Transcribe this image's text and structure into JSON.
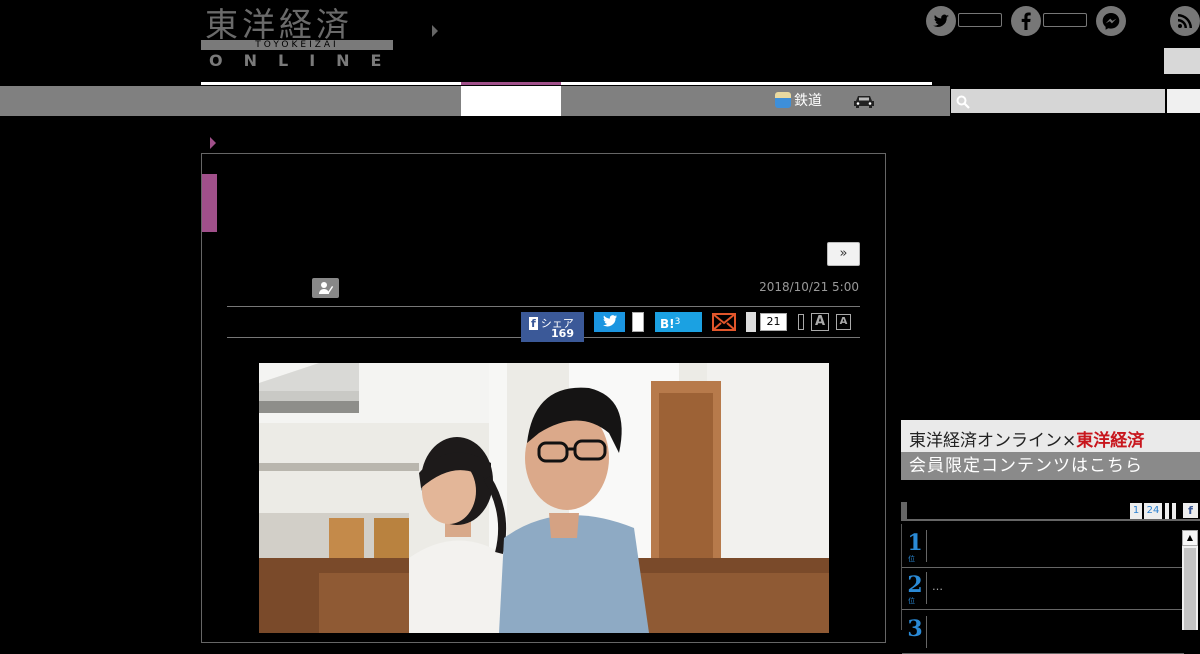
{
  "logo": {
    "kanji": "東洋経済",
    "band": "TOYOKEIZAI",
    "online": "ONLINE"
  },
  "nav": {
    "rail_label": "鉄道"
  },
  "article": {
    "next_label": "»",
    "date": "2018/10/21 5:00",
    "share": {
      "facebook_label": "シェア",
      "facebook_count": "169",
      "hatena_label": "B!",
      "hatena_count": "3",
      "comment_count": "21",
      "font_large": "A",
      "font_small": "A"
    }
  },
  "sidebar": {
    "banner_line1": "東洋経済オンライン×",
    "banner_line1_brand": "東洋経済",
    "banner_line2": "会員限定コンテンツはこちら",
    "ranking_tab1": "1",
    "ranking_tab2": "24",
    "ranking": [
      {
        "rank": "1",
        "sub": "位",
        "title": ""
      },
      {
        "rank": "2",
        "sub": "位",
        "title": "…"
      },
      {
        "rank": "3",
        "sub": "",
        "title": ""
      }
    ]
  },
  "colors": {
    "accent": "#a0508a",
    "facebook": "#3b5998",
    "twitter": "#1b95e0",
    "hatena": "#1ba1e2",
    "rank": "#2a8ad6"
  },
  "icons": [
    "twitter-icon",
    "facebook-icon",
    "messenger-icon",
    "rss-icon",
    "search-icon",
    "car-icon",
    "mail-icon",
    "author-icon"
  ]
}
